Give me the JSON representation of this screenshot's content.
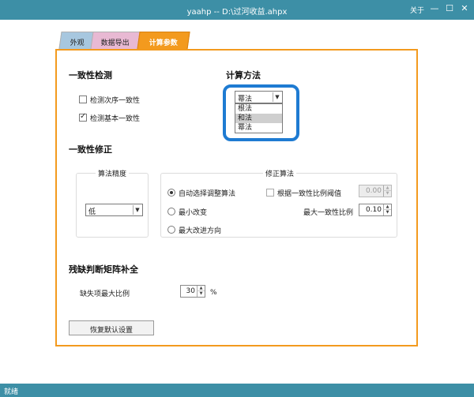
{
  "window": {
    "title": "yaahp  --  D:\\过河收益.ahpx",
    "about": "关于",
    "minimize": "—",
    "maximize": "☐",
    "close": "✕"
  },
  "tabs": [
    {
      "label": "外观"
    },
    {
      "label": "数据导出"
    },
    {
      "label": "计算参数"
    }
  ],
  "consistency_check": {
    "heading": "一致性检测",
    "items": [
      {
        "label": "检测次序一致性",
        "checked": false
      },
      {
        "label": "检测基本一致性",
        "checked": true
      }
    ]
  },
  "calc_method": {
    "heading": "计算方法",
    "selected": "幂法",
    "options": [
      "根法",
      "和法",
      "幂法"
    ],
    "highlighted_option": "和法",
    "highlight_color": "#1e7bd2"
  },
  "consistency_fix": {
    "heading": "一致性修正",
    "precision": {
      "title": "算法精度",
      "selected": "低"
    },
    "algorithm": {
      "title": "修正算法",
      "radios": [
        {
          "label": "自动选择调整算法",
          "checked": true
        },
        {
          "label": "最小改变",
          "checked": false
        },
        {
          "label": "最大改进方向",
          "checked": false
        }
      ],
      "threshold_checkbox": {
        "label": "根据一致性比例阈值",
        "checked": false
      },
      "threshold_value": "0.00",
      "max_ratio_label": "最大一致性比例",
      "max_ratio_value": "0.10"
    }
  },
  "missing_matrix": {
    "heading": "残缺判断矩阵补全",
    "max_ratio_label": "缺失项最大比例",
    "max_ratio_value": "30",
    "unit": "%"
  },
  "reset_button": "恢复默认设置",
  "status": "就绪",
  "colors": {
    "accent": "#f39a1e",
    "titlebar": "#3d8fa6"
  }
}
